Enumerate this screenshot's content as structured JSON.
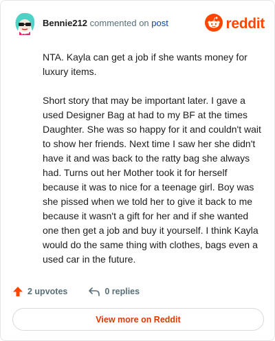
{
  "header": {
    "username": "Bennie212",
    "action_text": "commented on",
    "target_link": "post",
    "brand": "reddit",
    "logo_icon": "reddit-snoo-icon",
    "avatar_icon": "user-avatar-icon"
  },
  "comment": {
    "paragraphs": [
      "NTA. Kayla can get a job if she wants money for luxury items.",
      "Short story that may be important later. I gave a used Designer Bag at had to my BF at the times Daughter. She was so happy for it and couldn't wait to show her friends. Next time I saw her she didn't have it and was back to the ratty bag she always had. Turns out her Mother took it for herself because it was to nice for a teenage girl. Boy was she pissed when we told her to give it back to me because it wasn't a gift for her and if she wanted one then get a job and buy it yourself. I think Kayla would do the same thing with clothes, bags even a used car in the future."
    ]
  },
  "actions": {
    "upvotes": "2 upvotes",
    "replies": "0 replies",
    "upvote_icon": "upvote-arrow-icon",
    "reply_icon": "reply-arrow-icon"
  },
  "footer": {
    "view_more": "View more on Reddit"
  },
  "colors": {
    "brand": "#ff4500",
    "link": "#0a449b",
    "muted": "#576f76",
    "cta": "#d93a00"
  }
}
